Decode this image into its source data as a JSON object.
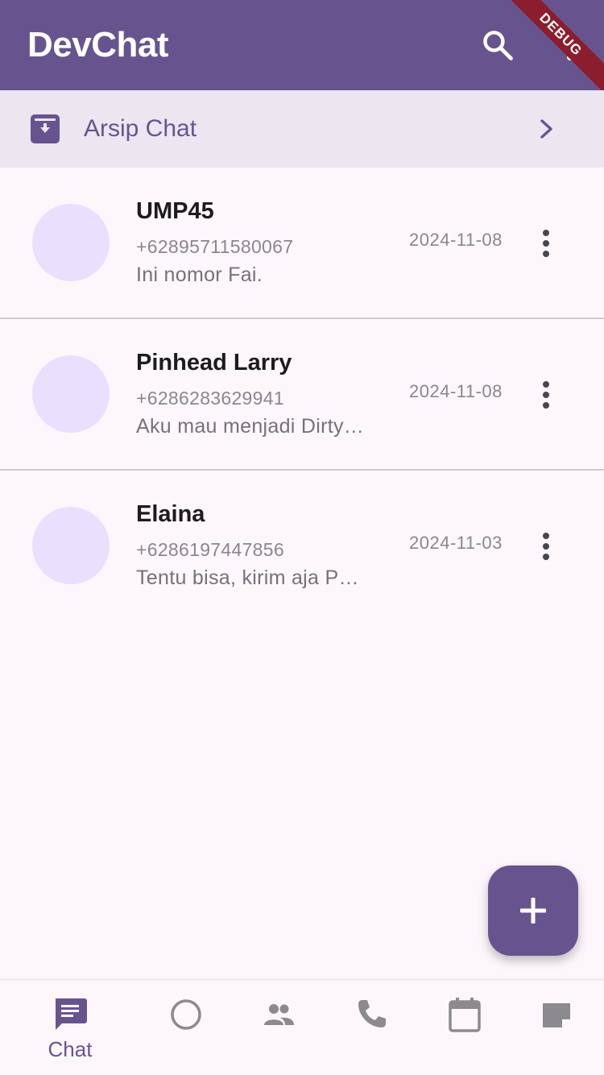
{
  "appbar": {
    "title": "DevChat",
    "search_icon": "search-icon",
    "more_icon": "more-vert-icon",
    "debug_label": "DEBUG",
    "background": "#67548f"
  },
  "archive": {
    "label": "Arsip Chat",
    "icon": "archive-icon",
    "chevron": "chevron-right-icon"
  },
  "chats": [
    {
      "name": "UMP45",
      "phone": "+62895711580067",
      "message": "Ini nomor Fai.",
      "date": "2024-11-08"
    },
    {
      "name": "Pinhead Larry",
      "phone": "+6286283629941",
      "message": "Aku mau menjadi Dirty…",
      "date": "2024-11-08"
    },
    {
      "name": "Elaina",
      "phone": "+6286197447856",
      "message": "Tentu bisa, kirim aja P…",
      "date": "2024-11-03"
    }
  ],
  "fab": {
    "icon": "add-icon"
  },
  "bottom_nav": {
    "active_index": 0,
    "items": [
      {
        "label": "Chat",
        "icon": "chat-icon"
      },
      {
        "label": "",
        "icon": "status-circle-icon"
      },
      {
        "label": "",
        "icon": "people-icon"
      },
      {
        "label": "",
        "icon": "phone-icon"
      },
      {
        "label": "",
        "icon": "calendar-icon"
      },
      {
        "label": "",
        "icon": "note-icon"
      }
    ]
  },
  "colors": {
    "primary": "#67548f",
    "avatar": "#e9e0fe",
    "archive_bg": "#ece6f1",
    "background": "#fdf7fc",
    "inactive_icon": "#8c8a8e"
  }
}
